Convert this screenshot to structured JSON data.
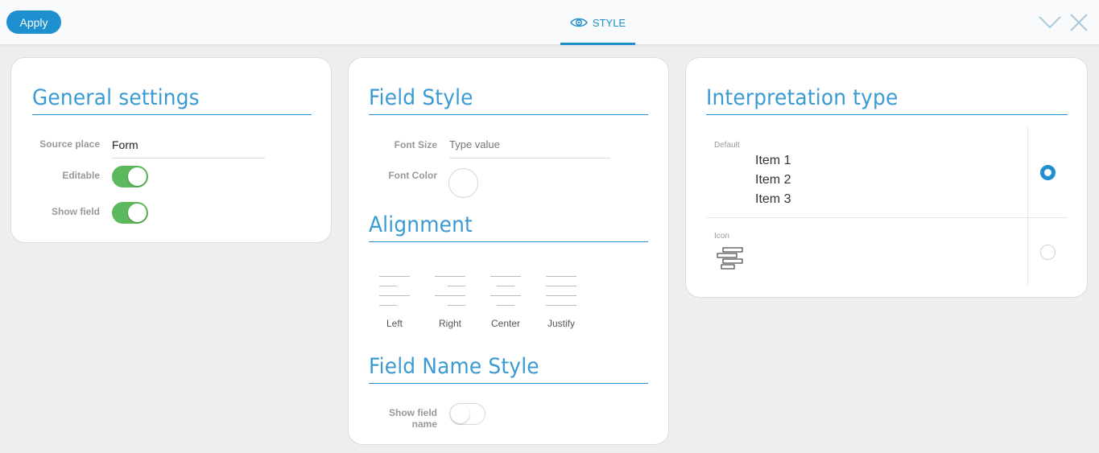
{
  "toolbar": {
    "apply_label": "Apply",
    "tab_label": "STYLE",
    "icons": {
      "tab": "eye-icon",
      "collapse": "chevron-down-icon",
      "close": "close-icon"
    }
  },
  "general": {
    "title": "General settings",
    "source_place_label": "Source place",
    "source_place_value": "Form",
    "editable_label": "Editable",
    "editable_on": true,
    "show_field_label": "Show field",
    "show_field_on": true
  },
  "field_style": {
    "title": "Field Style",
    "font_size_label": "Font Size",
    "font_size_placeholder": "Type value",
    "font_color_label": "Font Color"
  },
  "alignment": {
    "title": "Alignment",
    "options": [
      {
        "label": "Left",
        "icon": "align-left-icon"
      },
      {
        "label": "Right",
        "icon": "align-right-icon"
      },
      {
        "label": "Center",
        "icon": "align-center-icon"
      },
      {
        "label": "Justify",
        "icon": "align-justify-icon"
      }
    ]
  },
  "field_name_style": {
    "title": "Field Name Style",
    "show_field_name_label_1": "Show field",
    "show_field_name_label_2": "name",
    "show_field_name_on": false
  },
  "interpretation": {
    "title": "Interpretation type",
    "options": [
      {
        "label": "Default",
        "items": [
          "Item 1",
          "Item 2",
          "Item 3"
        ],
        "selected": true
      },
      {
        "label": "Icon",
        "icon": "list-icon",
        "selected": false
      }
    ]
  },
  "colors": {
    "accent": "#1e8fcf",
    "toggle_on": "#5cb85c"
  }
}
